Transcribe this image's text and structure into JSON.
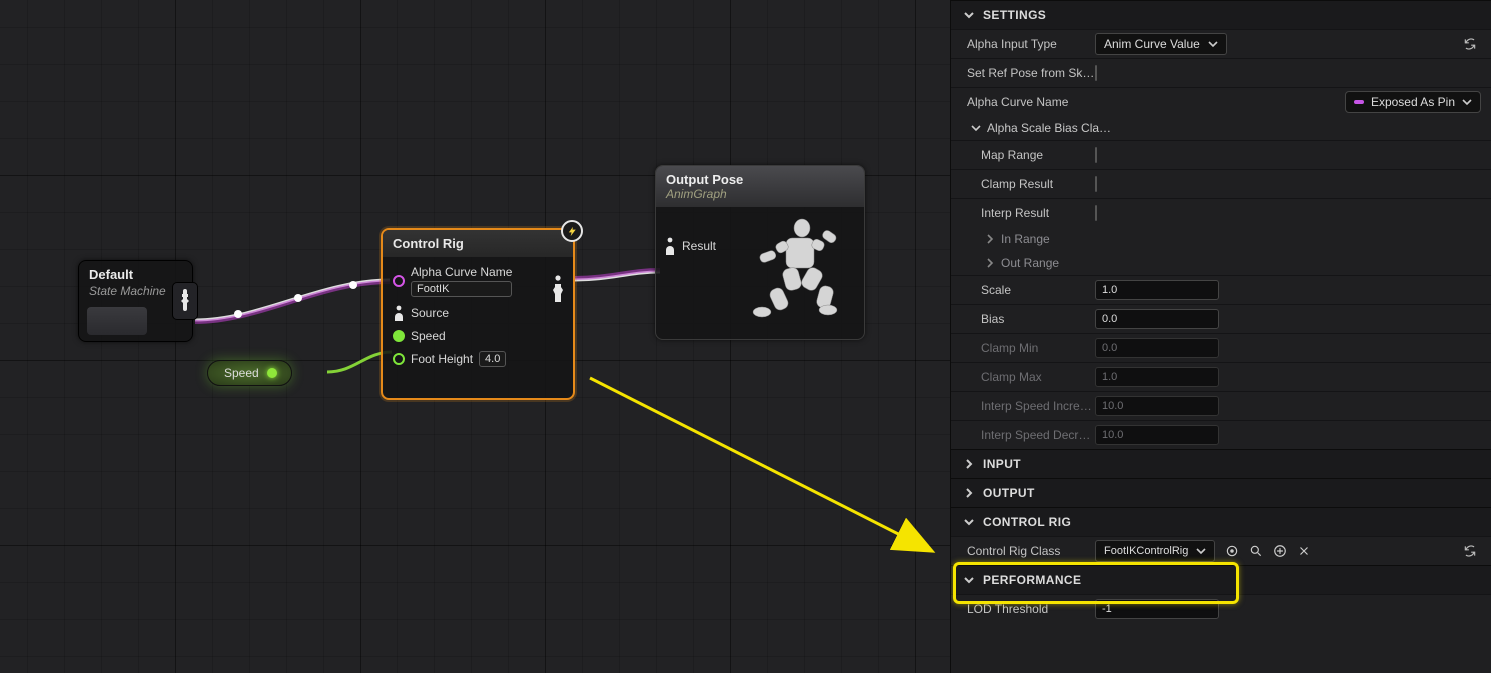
{
  "graph": {
    "default_node": {
      "title": "Default",
      "subtitle": "State Machine"
    },
    "control_rig_node": {
      "title": "Control Rig",
      "alpha_curve_label": "Alpha Curve Name",
      "alpha_curve_value": "FootIK",
      "source_label": "Source",
      "speed_label": "Speed",
      "foot_height_label": "Foot Height",
      "foot_height_value": "4.0"
    },
    "output_node": {
      "title": "Output Pose",
      "subtitle": "AnimGraph",
      "result_label": "Result"
    },
    "speed_chip": "Speed"
  },
  "panel": {
    "settings": {
      "header": "Settings",
      "alpha_input_type": {
        "label": "Alpha Input Type",
        "value": "Anim Curve Value"
      },
      "set_ref_pose": {
        "label": "Set Ref Pose from Skel…"
      },
      "alpha_curve_name": {
        "label": "Alpha Curve Name",
        "pill": "Exposed As Pin"
      },
      "alpha_scale_bias": {
        "header": "Alpha Scale Bias Cla…",
        "map_range": "Map Range",
        "clamp_result": "Clamp Result",
        "interp_result": "Interp Result",
        "in_range": "In Range",
        "out_range": "Out Range",
        "scale": {
          "label": "Scale",
          "value": "1.0"
        },
        "bias": {
          "label": "Bias",
          "value": "0.0"
        },
        "clamp_min": {
          "label": "Clamp Min",
          "value": "0.0"
        },
        "clamp_max": {
          "label": "Clamp Max",
          "value": "1.0"
        },
        "interp_inc": {
          "label": "Interp Speed Increas…",
          "value": "10.0"
        },
        "interp_dec": {
          "label": "Interp Speed Decrea…",
          "value": "10.0"
        }
      }
    },
    "input": {
      "header": "Input"
    },
    "output": {
      "header": "Output"
    },
    "control_rig": {
      "header": "Control Rig",
      "class_label": "Control Rig Class",
      "class_value": "FootIKControlRig"
    },
    "performance": {
      "header": "Performance",
      "lod_threshold": {
        "label": "LOD Threshold",
        "value": "-1"
      }
    }
  }
}
